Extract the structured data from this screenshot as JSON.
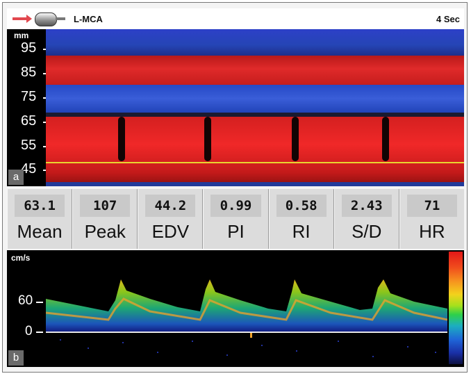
{
  "header": {
    "probe_title": "L-MCA",
    "time_label": "4 Sec",
    "icons": [
      "arrow-right-icon",
      "probe-icon"
    ]
  },
  "mmode": {
    "panel_letter": "a",
    "unit": "mm",
    "ticks": [
      "95",
      "85",
      "75",
      "65",
      "55",
      "45"
    ]
  },
  "metrics": [
    {
      "value": "63.1",
      "label": "Mean"
    },
    {
      "value": "107",
      "label": "Peak"
    },
    {
      "value": "44.2",
      "label": "EDV"
    },
    {
      "value": "0.99",
      "label": "PI"
    },
    {
      "value": "0.58",
      "label": "RI"
    },
    {
      "value": "2.43",
      "label": "S/D"
    },
    {
      "value": "71",
      "label": "HR"
    }
  ],
  "spectral": {
    "panel_letter": "b",
    "unit": "cm/s",
    "ticks": [
      "60",
      "0"
    ]
  },
  "colors": {
    "flow_toward": "#e02a2a",
    "flow_away": "#2d40c8",
    "gate_line": "#e8d530"
  }
}
